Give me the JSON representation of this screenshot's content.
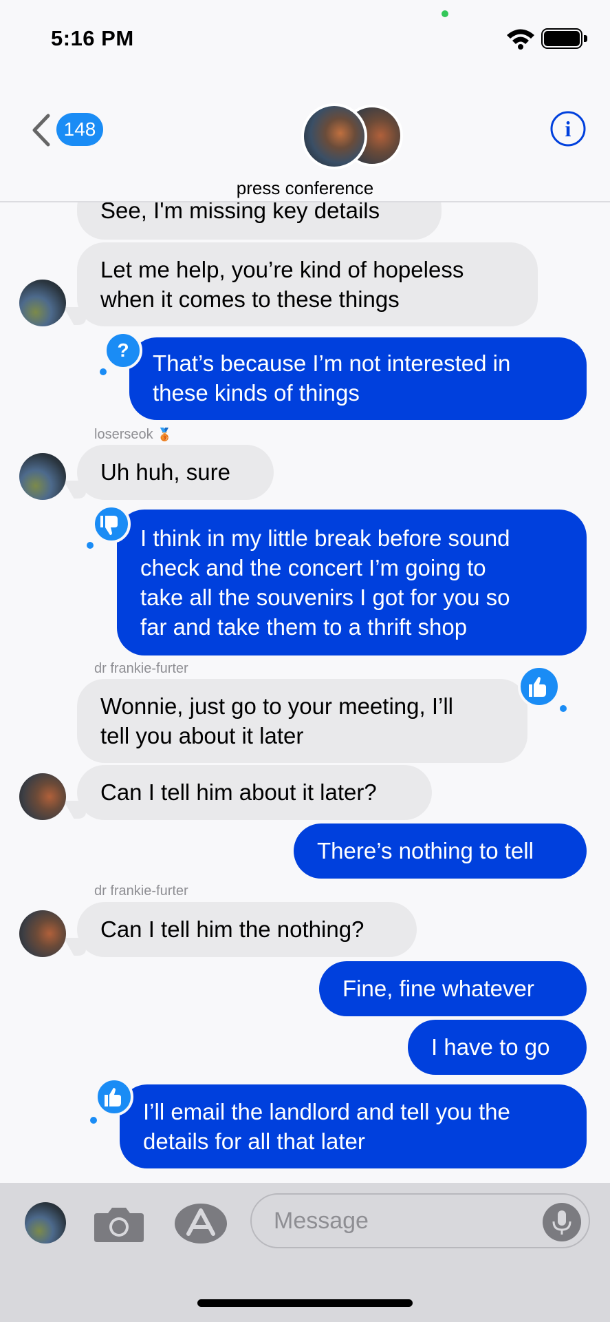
{
  "status_bar": {
    "time": "5:16 PM"
  },
  "header": {
    "back_count": "148",
    "group_title": "press conference"
  },
  "messages": {
    "m0": {
      "text": "See, I'm missing key details"
    },
    "m1": {
      "line1": "Let me help, you’re kind of hopeless",
      "line2": "when it comes to these things"
    },
    "m2": {
      "line1": "That’s because I’m not interested in",
      "line2": "these kinds of things",
      "tapback": "?"
    },
    "m3": {
      "sender": "loserseok",
      "sender_badge": "🥉",
      "text": "Uh huh, sure"
    },
    "m4": {
      "line1": "I think in my little break before sound",
      "line2": "check and the concert I’m going to",
      "line3": "take all the souvenirs I got for you so",
      "line4": "far and take them to a thrift shop",
      "tapback": "thumbs-down-icon"
    },
    "m5": {
      "sender": "dr frankie-furter",
      "line1": "Wonnie, just go to your meeting, I’ll",
      "line2": "tell you about it later",
      "tapback": "thumbs-up-icon"
    },
    "m6": {
      "text": "Can I tell him about it later?"
    },
    "m7": {
      "text": "There’s nothing to tell"
    },
    "m8": {
      "sender": "dr frankie-furter",
      "text": "Can I tell him the nothing?"
    },
    "m9": {
      "text": "Fine, fine whatever"
    },
    "m10": {
      "text": "I have to go"
    },
    "m11": {
      "line1": "I’ll email the landlord and tell you the",
      "line2": "details for all that later",
      "tapback": "thumbs-up-icon"
    }
  },
  "compose": {
    "placeholder": "Message"
  },
  "colors": {
    "sent_bubble": "#0040dd",
    "received_bubble": "#e9e9eb",
    "accent": "#1a8cf5"
  }
}
